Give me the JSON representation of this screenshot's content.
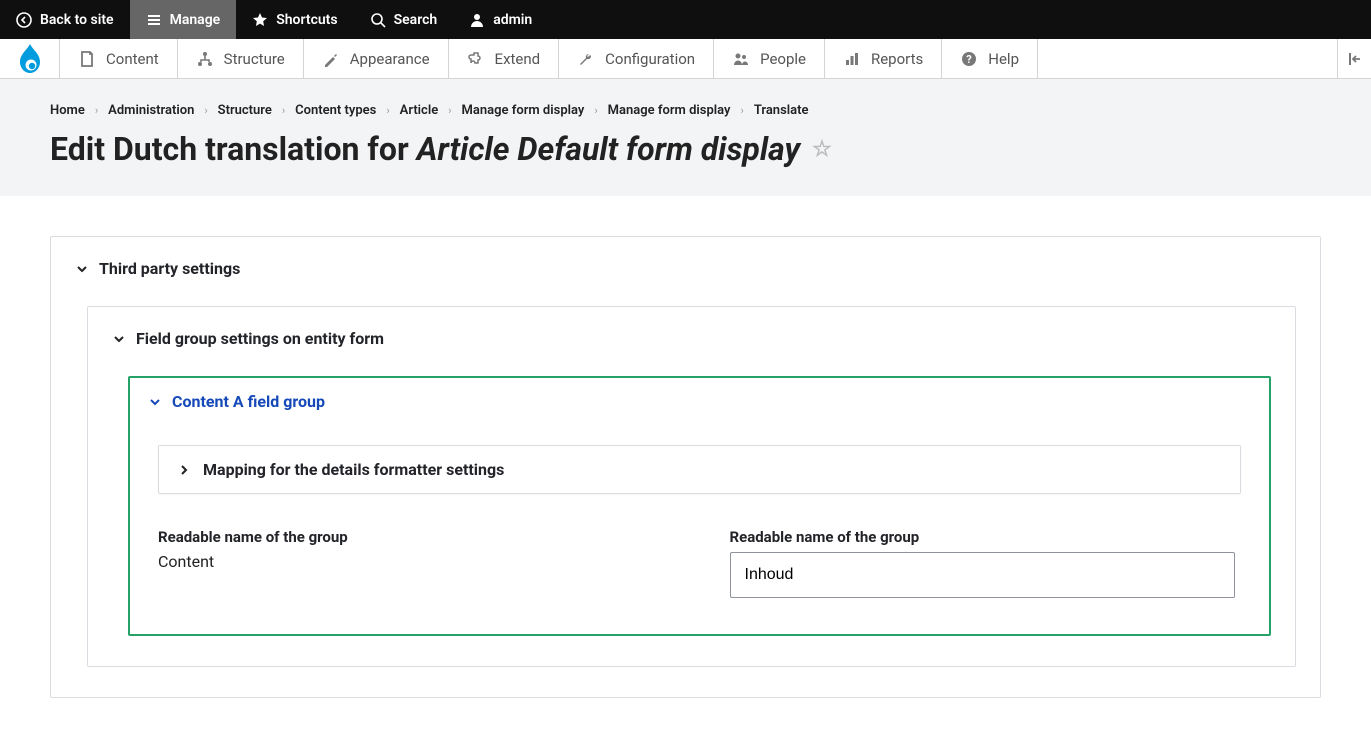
{
  "topbar": {
    "back": "Back to site",
    "manage": "Manage",
    "shortcuts": "Shortcuts",
    "search": "Search",
    "user": "admin"
  },
  "admin_menu": {
    "content": "Content",
    "structure": "Structure",
    "appearance": "Appearance",
    "extend": "Extend",
    "configuration": "Configuration",
    "people": "People",
    "reports": "Reports",
    "help": "Help"
  },
  "breadcrumb": [
    "Home",
    "Administration",
    "Structure",
    "Content types",
    "Article",
    "Manage form display",
    "Manage form display",
    "Translate"
  ],
  "title_prefix": "Edit Dutch translation for ",
  "title_em": "Article Default form display",
  "panels": {
    "third_party": "Third party settings",
    "field_group": "Field group settings on entity form",
    "content_a": "Content A field group",
    "mapping": "Mapping for the details formatter settings"
  },
  "field": {
    "label": "Readable name of the group",
    "source_value": "Content",
    "translation_value": "Inhoud"
  }
}
